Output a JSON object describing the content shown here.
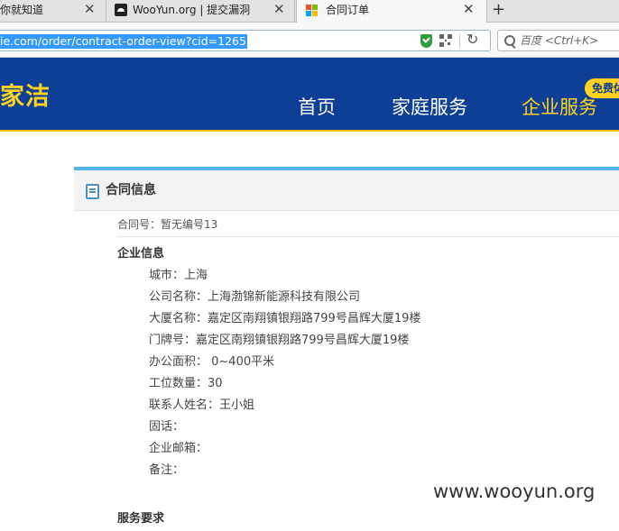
{
  "browser": {
    "tabs": [
      {
        "title": "你就知道",
        "close": "✕"
      },
      {
        "title": "WooYun.org | 提交漏洞",
        "close": "✕"
      },
      {
        "title": "合同订单",
        "close": "✕"
      }
    ],
    "new_tab": "+",
    "url": "ie.com/order/contract-order-view?cid=1265",
    "reload_glyph": "↻",
    "search_placeholder": "百度 <Ctrl+K>"
  },
  "site": {
    "logo": "家洁",
    "nav": [
      "首页",
      "家庭服务",
      "企业服务"
    ],
    "badge": "免费体"
  },
  "panel": {
    "title": "合同信息",
    "contract_no": "合同号：暂无编号13",
    "section_enterprise": "企业信息",
    "fields": [
      "城市：上海",
      "公司名称：上海渤锦新能源科技有限公司",
      "大厦名称：嘉定区南翔镇银翔路799号昌辉大厦19楼",
      "门牌号：嘉定区南翔镇银翔路799号昌辉大厦19楼",
      "办公面积： 0~400平米",
      "工位数量：30",
      "联系人姓名：王小姐",
      "固话：",
      "企业邮箱：",
      "备注："
    ],
    "section_service": "服务要求"
  },
  "watermark": "www.wooyun.org",
  "colors": {
    "header_bg": "#0c3f95",
    "accent_yellow": "#ffd21f",
    "panel_border": "#55b4e6",
    "url_highlight": "#3399ff"
  }
}
